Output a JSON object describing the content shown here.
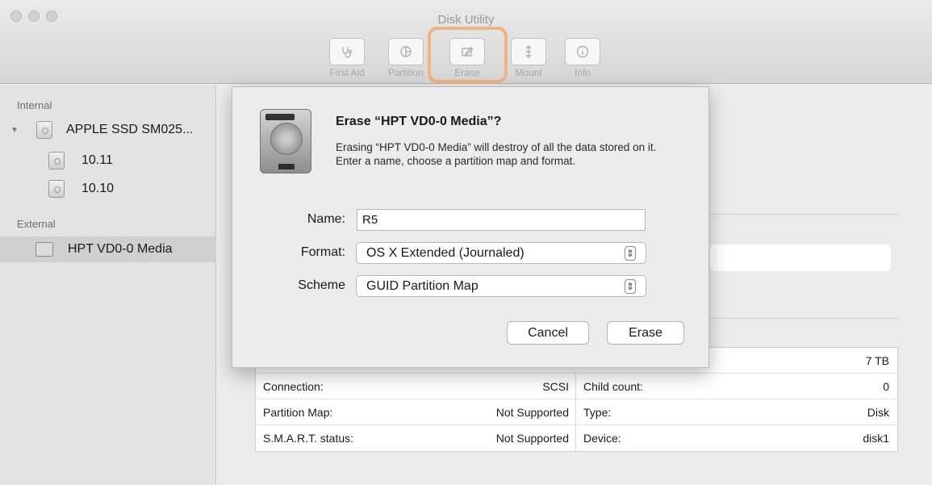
{
  "window": {
    "title": "Disk Utility"
  },
  "toolbar": {
    "buttons": [
      {
        "label": "First Aid",
        "icon": "stethoscope-icon"
      },
      {
        "label": "Partition",
        "icon": "partition-icon"
      },
      {
        "label": "Erase",
        "icon": "erase-icon"
      },
      {
        "label": "Mount",
        "icon": "mount-icon"
      },
      {
        "label": "Info",
        "icon": "info-icon"
      }
    ],
    "highlight_color": "#f3b27f"
  },
  "sidebar": {
    "internal_title": "Internal",
    "internal_items": [
      {
        "label": "APPLE SSD SM025..."
      },
      {
        "label": "10.11"
      },
      {
        "label": "10.10"
      }
    ],
    "external_title": "External",
    "external_items": [
      {
        "label": "HPT VD0-0 Media",
        "selected": true
      }
    ]
  },
  "info_table": {
    "size_value": "7 TB",
    "rows": [
      {
        "left_label": "Connection:",
        "left_value": "SCSI",
        "right_label": "Child count:",
        "right_value": "0"
      },
      {
        "left_label": "Partition Map:",
        "left_value": "Not Supported",
        "right_label": "Type:",
        "right_value": "Disk"
      },
      {
        "left_label": "S.M.A.R.T. status:",
        "left_value": "Not Supported",
        "right_label": "Device:",
        "right_value": "disk1"
      }
    ]
  },
  "dialog": {
    "title": "Erase “HPT VD0-0 Media”?",
    "message": "Erasing “HPT VD0-0 Media” will destroy of all the data stored on it. Enter a name, choose a partition map and format.",
    "name_label": "Name:",
    "name_value": "R5",
    "format_label": "Format:",
    "format_value": "OS X Extended (Journaled)",
    "scheme_label": "Scheme",
    "scheme_value": "GUID Partition Map",
    "cancel_label": "Cancel",
    "erase_label": "Erase"
  }
}
